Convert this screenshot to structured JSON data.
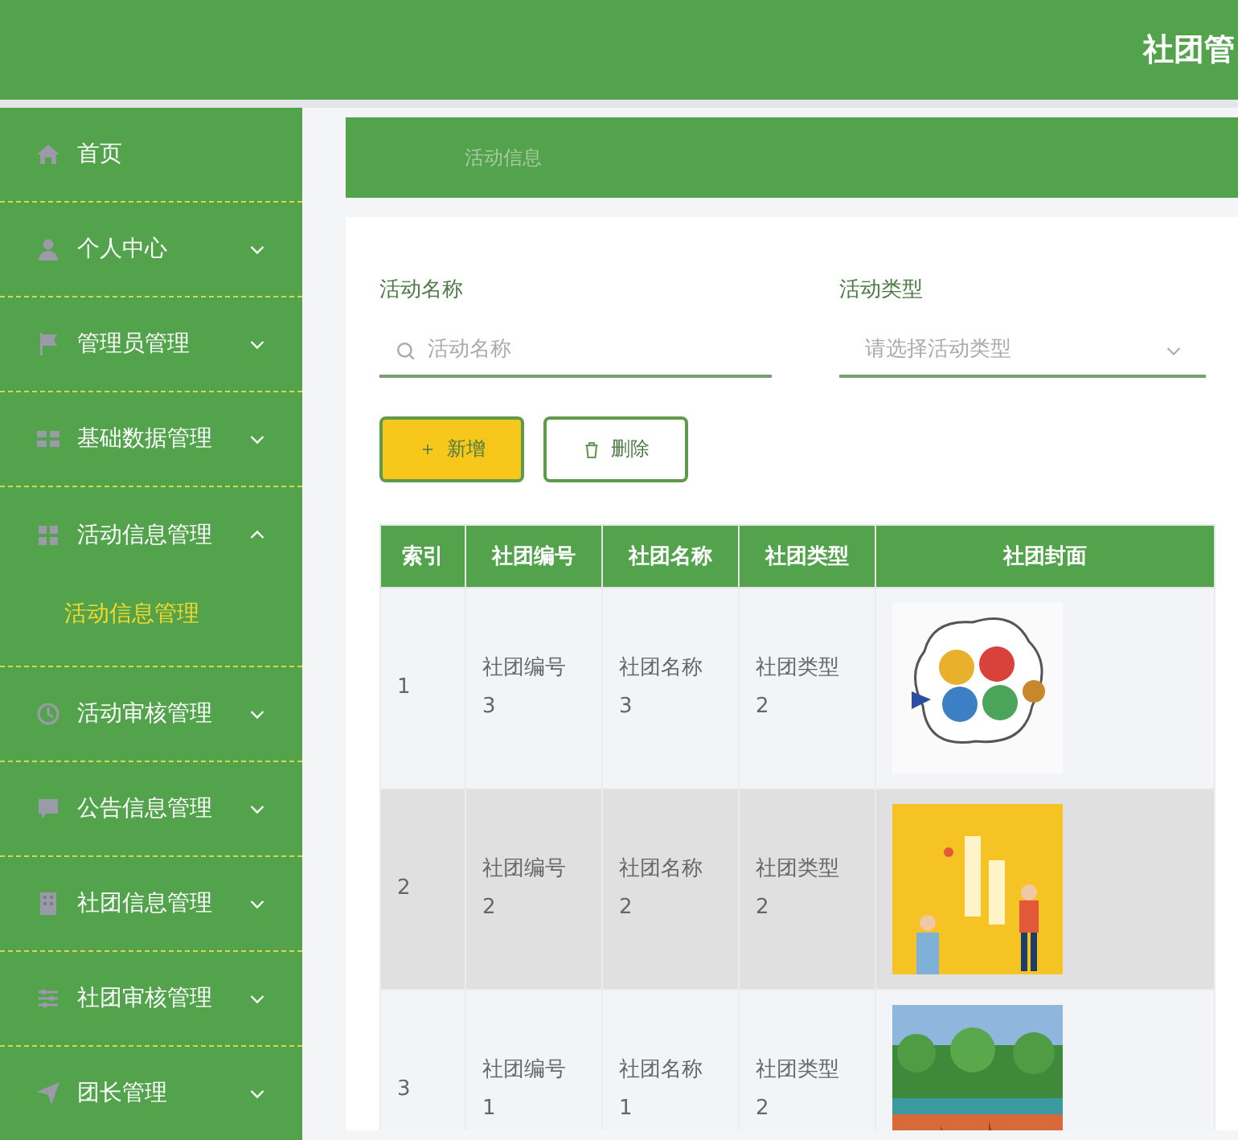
{
  "header": {
    "title": "社团管"
  },
  "sidebar": {
    "items": [
      {
        "label": "首页"
      },
      {
        "label": "个人中心",
        "expanded": false
      },
      {
        "label": "管理员管理",
        "expanded": false
      },
      {
        "label": "基础数据管理",
        "expanded": false
      },
      {
        "label": "活动信息管理",
        "expanded": true,
        "children": [
          {
            "label": "活动信息管理",
            "selected": true
          }
        ]
      },
      {
        "label": "活动审核管理",
        "expanded": false
      },
      {
        "label": "公告信息管理",
        "expanded": false
      },
      {
        "label": "社团信息管理",
        "expanded": false
      },
      {
        "label": "社团审核管理",
        "expanded": false
      },
      {
        "label": "团长管理",
        "expanded": false
      }
    ]
  },
  "breadcrumb": "活动信息",
  "filters": [
    {
      "kind": "search",
      "label": "活动名称",
      "placeholder": "活动名称"
    },
    {
      "kind": "select",
      "label": "活动类型",
      "placeholder": "请选择活动类型"
    }
  ],
  "buttons": [
    {
      "kind": "add",
      "icon": "＋",
      "label": "新增"
    },
    {
      "kind": "delete",
      "label": "删除"
    }
  ],
  "table": {
    "columns": [
      "索引",
      "社团编号",
      "社团名称",
      "社团类型",
      "社团封面"
    ],
    "rows": [
      {
        "selected": false,
        "cells": [
          "1",
          "社团编号\n3",
          "社团名称\n3",
          "社团类型\n2"
        ],
        "cover": {
          "kind": "picture"
        }
      },
      {
        "selected": true,
        "cells": [
          "2",
          "社团编号\n2",
          "社团名称\n2",
          "社团类型\n2"
        ],
        "cover": {
          "kind": "picture"
        }
      },
      {
        "selected": false,
        "cells": [
          "3",
          "社团编号\n1",
          "社团名称\n1",
          "社团类型\n2"
        ],
        "cover": {
          "kind": "picture"
        }
      }
    ]
  }
}
